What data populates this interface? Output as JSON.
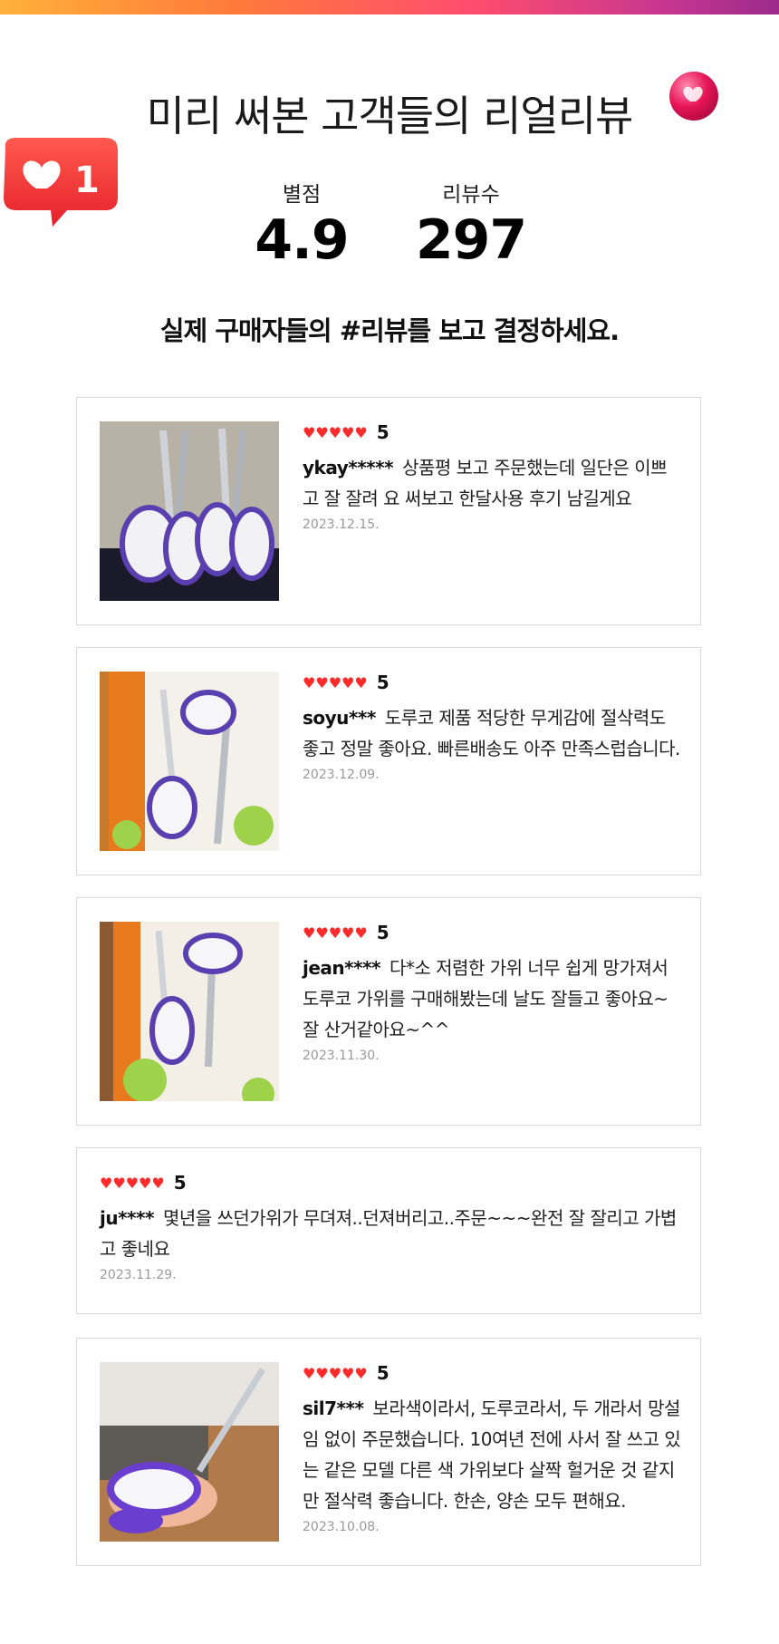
{
  "header": {
    "title": "미리 써본 고객들의 리얼리뷰",
    "rating_label": "별점",
    "rating_value": "4.9",
    "count_label": "리뷰수",
    "count_value": "297",
    "subtitle": "실제 구매자들의 #리뷰를 보고 결정하세요.",
    "bubble_count": "1"
  },
  "colors": {
    "accent": "#ff2a2a",
    "bubble": "#ff3b3b",
    "orb": "#e8155a"
  },
  "reviews": [
    {
      "hearts": "♥♥♥♥♥",
      "score": "5",
      "user": "ykay*****",
      "text": "상품평 보고 주문했는데 일단은 이쁘고 잘 잘려 요 써보고 한달사용 후기 남길게요",
      "date": "2023.12.15.",
      "has_photo": true,
      "photo_icon": "scissors-photo"
    },
    {
      "hearts": "♥♥♥♥♥",
      "score": "5",
      "user": "soyu***",
      "text": "도루코 제품 적당한 무게감에 절삭력도 좋고 정말 좋아요. 빠른배송도 아주 만족스럽습니다.",
      "date": "2023.12.09.",
      "has_photo": true,
      "photo_icon": "scissors-box-photo"
    },
    {
      "hearts": "♥♥♥♥♥",
      "score": "5",
      "user": "jean****",
      "text": "다*소 저렴한 가위 너무 쉽게 망가져서 도루코 가위를 구매해봤는데 날도 잘들고 좋아요~ 잘 산거같아요~^^",
      "date": "2023.11.30.",
      "has_photo": true,
      "photo_icon": "scissors-box-photo"
    },
    {
      "hearts": "♥♥♥♥♥",
      "score": "5",
      "user": "ju****",
      "text": "몇년을 쓰던가위가 무뎌져..던져버리고..주문~~~완전 잘 잘리고 가볍고 좋네요",
      "date": "2023.11.29.",
      "has_photo": false
    },
    {
      "hearts": "♥♥♥♥♥",
      "score": "5",
      "user": "sil7***",
      "text": "보라색이라서, 도루코라서, 두 개라서 망설임 없이 주문했습니다. 10여년 전에 사서 잘 쓰고 있는 같은 모델 다른 색 가위보다 살짝 헐거운 것 같지만 절삭력 좋습니다. 한손, 양손 모두 편해요.",
      "date": "2023.10.08.",
      "has_photo": true,
      "photo_icon": "scissors-hand-photo"
    }
  ]
}
